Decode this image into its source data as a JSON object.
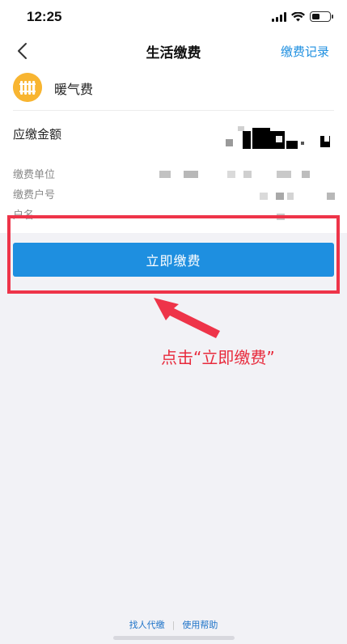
{
  "status": {
    "time": "12:25"
  },
  "nav": {
    "title": "生活缴费",
    "right_link": "缴费记录"
  },
  "biz": {
    "name": "暖气费",
    "icon": "radiator-icon"
  },
  "amount": {
    "label": "应缴金额"
  },
  "info": [
    {
      "label": "缴费单位"
    },
    {
      "label": "缴费户号"
    },
    {
      "label": "户名"
    }
  ],
  "action": {
    "pay_label": "立即缴费"
  },
  "annotation": {
    "text": "点击“立即缴费”",
    "color": "#e82a3c"
  },
  "footer": {
    "left_link": "找人代缴",
    "right_link": "使用帮助"
  },
  "colors": {
    "accent": "#1e8fe0",
    "icon_bg": "#f8b531",
    "highlight": "#ee3449"
  }
}
